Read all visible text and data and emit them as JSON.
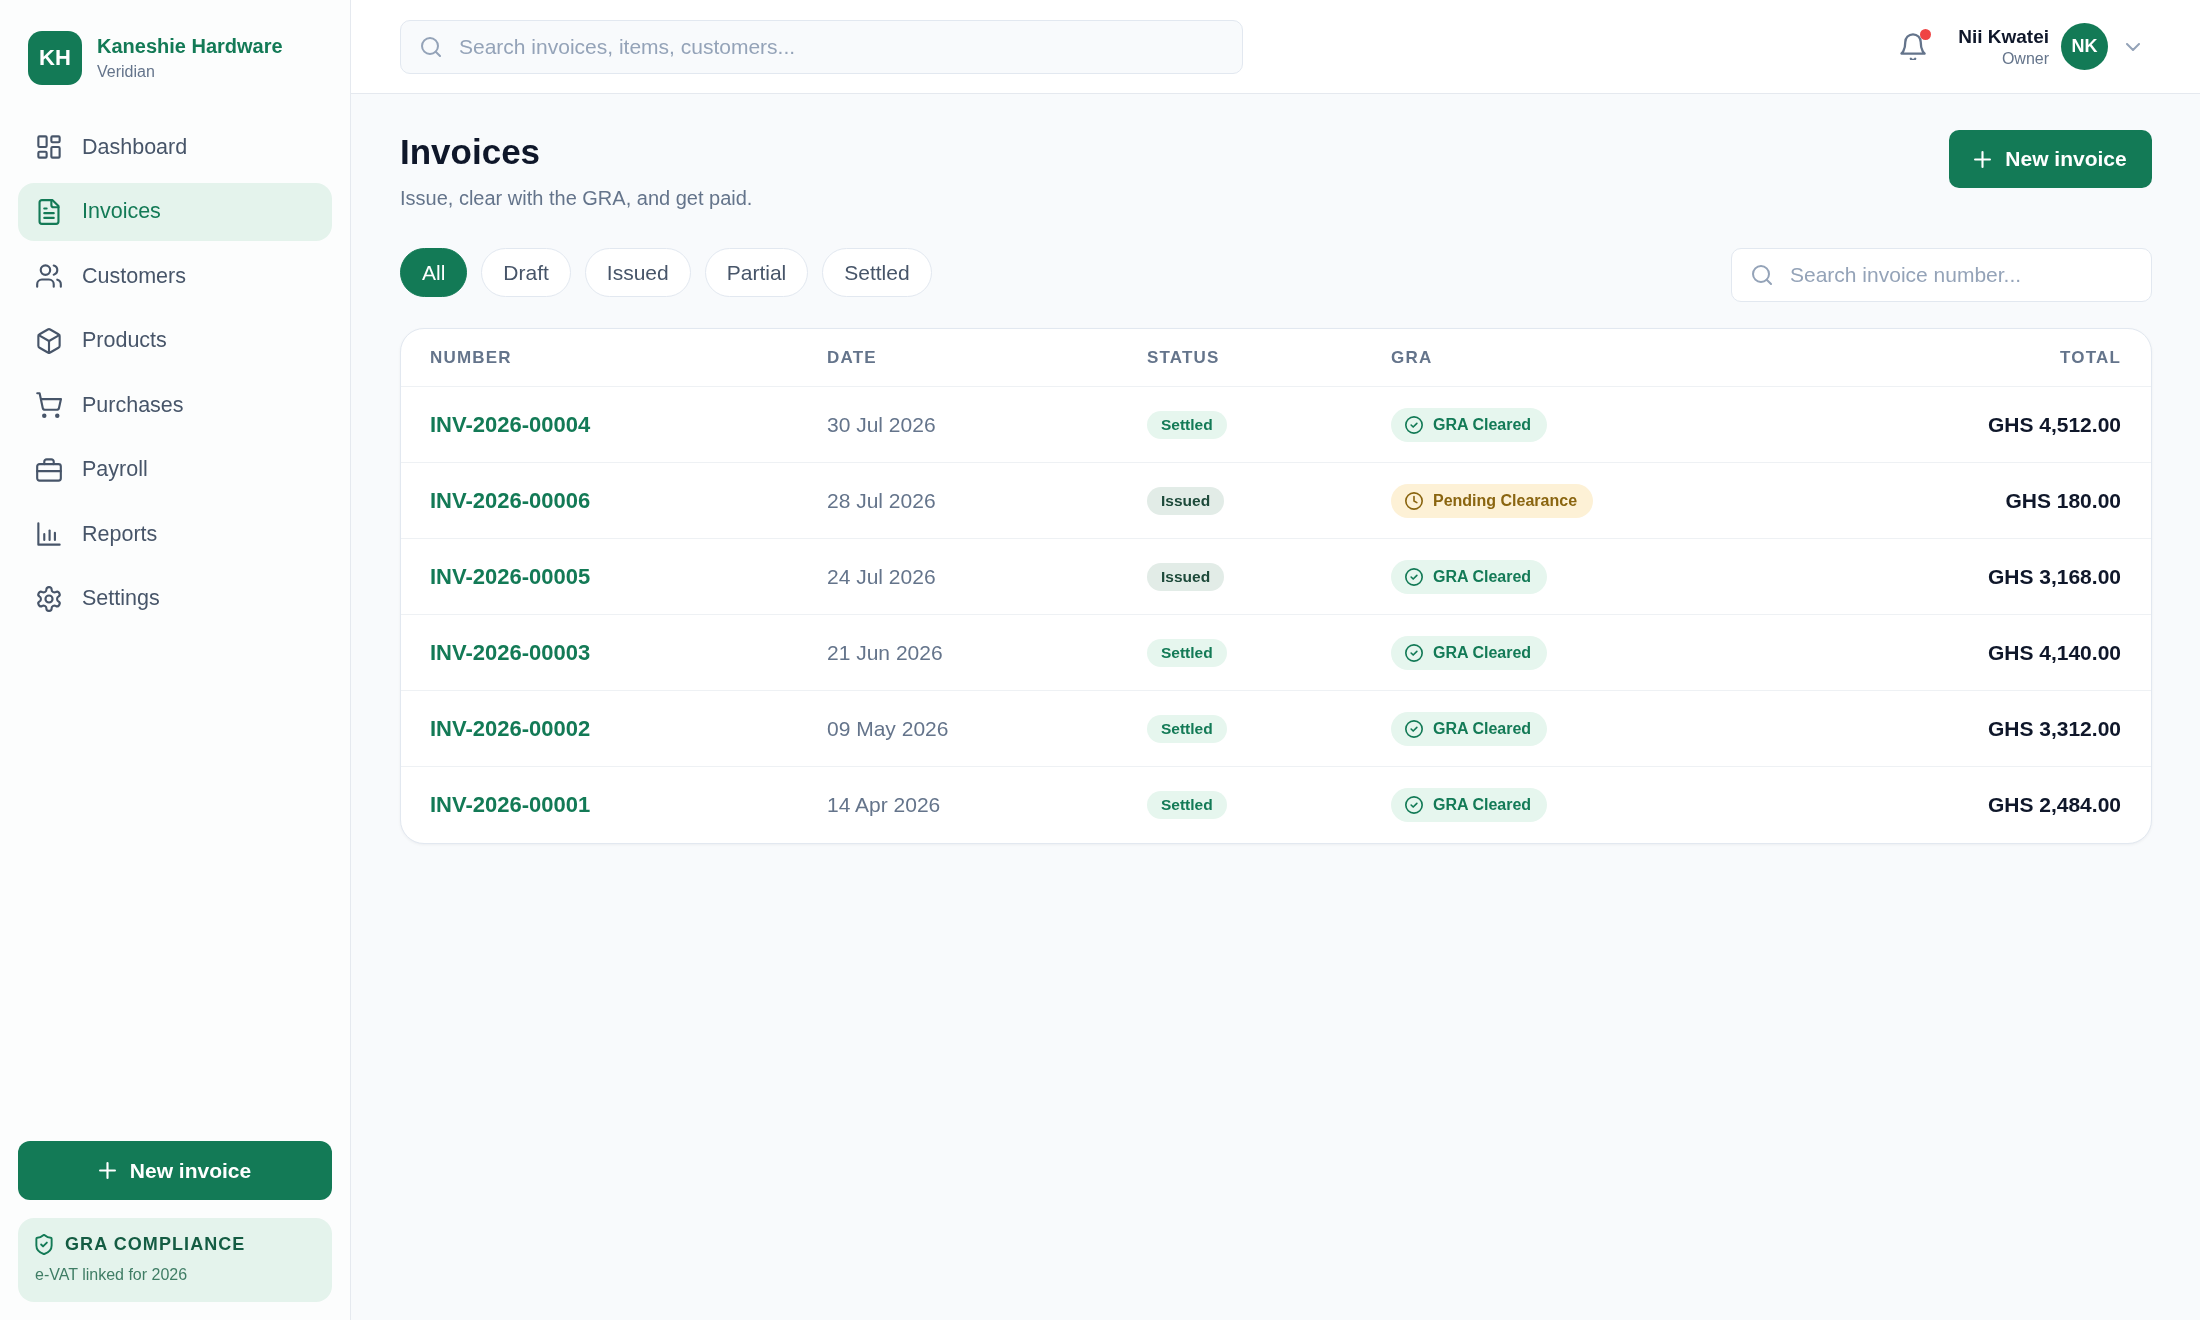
{
  "sidebar": {
    "brand": {
      "initials": "KH",
      "name": "Kaneshie Hardware",
      "subtitle": "Veridian"
    },
    "nav": [
      {
        "label": "Dashboard",
        "selected": false
      },
      {
        "label": "Invoices",
        "selected": true
      },
      {
        "label": "Customers",
        "selected": false
      },
      {
        "label": "Products",
        "selected": false
      },
      {
        "label": "Purchases",
        "selected": false
      },
      {
        "label": "Payroll",
        "selected": false
      },
      {
        "label": "Reports",
        "selected": false
      },
      {
        "label": "Settings",
        "selected": false
      }
    ],
    "new_invoice_button": {
      "label": "New invoice"
    },
    "compliance": {
      "title": "GRA COMPLIANCE",
      "text": "e-VAT linked for 2026"
    }
  },
  "topbar": {
    "search": {
      "placeholder": "Search invoices, items, customers..."
    },
    "notifications": {
      "unread": true
    },
    "user": {
      "name": "Nii Kwatei",
      "role": "Owner",
      "initials": "NK"
    }
  },
  "page": {
    "title": "Invoices",
    "subtitle": "Issue, clear with the GRA, and get paid.",
    "new_invoice_button": {
      "label": "New invoice"
    }
  },
  "filters": [
    {
      "label": "All",
      "selected": true
    },
    {
      "label": "Draft",
      "selected": false
    },
    {
      "label": "Issued",
      "selected": false
    },
    {
      "label": "Partial",
      "selected": false
    },
    {
      "label": "Settled",
      "selected": false
    }
  ],
  "invoice_search": {
    "placeholder": "Search invoice number..."
  },
  "table": {
    "columns": [
      "NUMBER",
      "DATE",
      "STATUS",
      "GRA",
      "TOTAL"
    ],
    "rows": [
      {
        "number": "INV-2026-00004",
        "date": "30 Jul 2026",
        "status": {
          "label": "Settled",
          "kind": "settled"
        },
        "gra": {
          "label": "GRA Cleared",
          "kind": "cleared"
        },
        "total": "GHS 4,512.00"
      },
      {
        "number": "INV-2026-00006",
        "date": "28 Jul 2026",
        "status": {
          "label": "Issued",
          "kind": "issued"
        },
        "gra": {
          "label": "Pending Clearance",
          "kind": "pending"
        },
        "total": "GHS 180.00"
      },
      {
        "number": "INV-2026-00005",
        "date": "24 Jul 2026",
        "status": {
          "label": "Issued",
          "kind": "issued"
        },
        "gra": {
          "label": "GRA Cleared",
          "kind": "cleared"
        },
        "total": "GHS 3,168.00"
      },
      {
        "number": "INV-2026-00003",
        "date": "21 Jun 2026",
        "status": {
          "label": "Settled",
          "kind": "settled"
        },
        "gra": {
          "label": "GRA Cleared",
          "kind": "cleared"
        },
        "total": "GHS 4,140.00"
      },
      {
        "number": "INV-2026-00002",
        "date": "09 May 2026",
        "status": {
          "label": "Settled",
          "kind": "settled"
        },
        "gra": {
          "label": "GRA Cleared",
          "kind": "cleared"
        },
        "total": "GHS 3,312.00"
      },
      {
        "number": "INV-2026-00001",
        "date": "14 Apr 2026",
        "status": {
          "label": "Settled",
          "kind": "settled"
        },
        "gra": {
          "label": "GRA Cleared",
          "kind": "cleared"
        },
        "total": "GHS 2,484.00"
      }
    ]
  }
}
